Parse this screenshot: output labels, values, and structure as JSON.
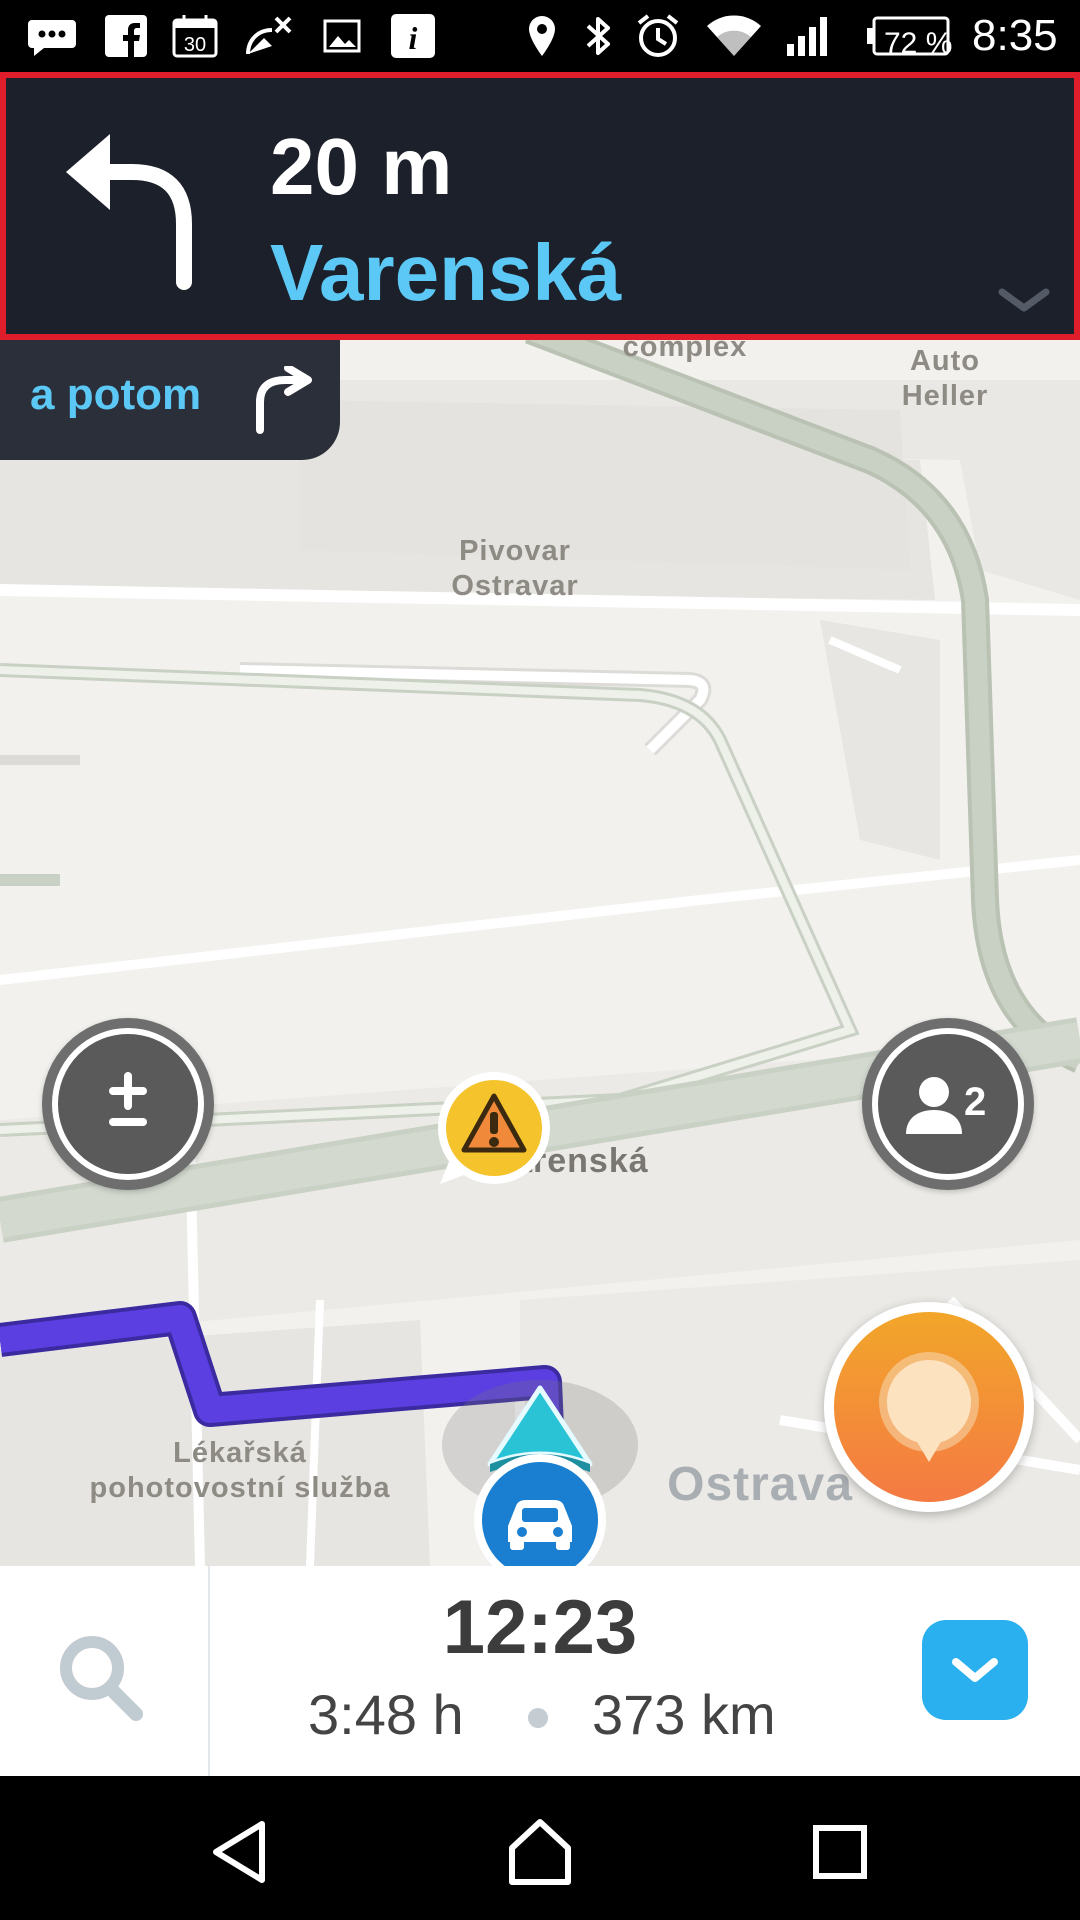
{
  "status_bar": {
    "battery": "72 %",
    "time": "8:35",
    "calendar_day": "30",
    "icons": [
      "chat-icon",
      "facebook-icon",
      "calendar-icon",
      "no-satellite-icon",
      "image-icon",
      "info-icon",
      "location-icon",
      "bluetooth-icon",
      "alarm-icon",
      "wifi-icon",
      "signal-icon",
      "battery-icon"
    ]
  },
  "navigation": {
    "distance": "20 m",
    "street": "Varenská",
    "then_label": "a potom"
  },
  "map": {
    "labels": {
      "complex": "complex",
      "auto_heller": "Auto\nHeller",
      "pivovar": "Pivovar\nOstravar",
      "varenska": "Varenská",
      "lekarska": "Lékařská\npohotovostní služba",
      "ostrava": "Ostrava"
    },
    "riders_count": "2"
  },
  "bottom_bar": {
    "eta": "12:23",
    "duration": "3:48 h",
    "distance": "373 km"
  },
  "colors": {
    "panel": "#1c202a",
    "accent": "#5cc8f5",
    "highlight_border": "#e01e2b",
    "route": "#5b3fe0",
    "report": "#f08a3a"
  }
}
